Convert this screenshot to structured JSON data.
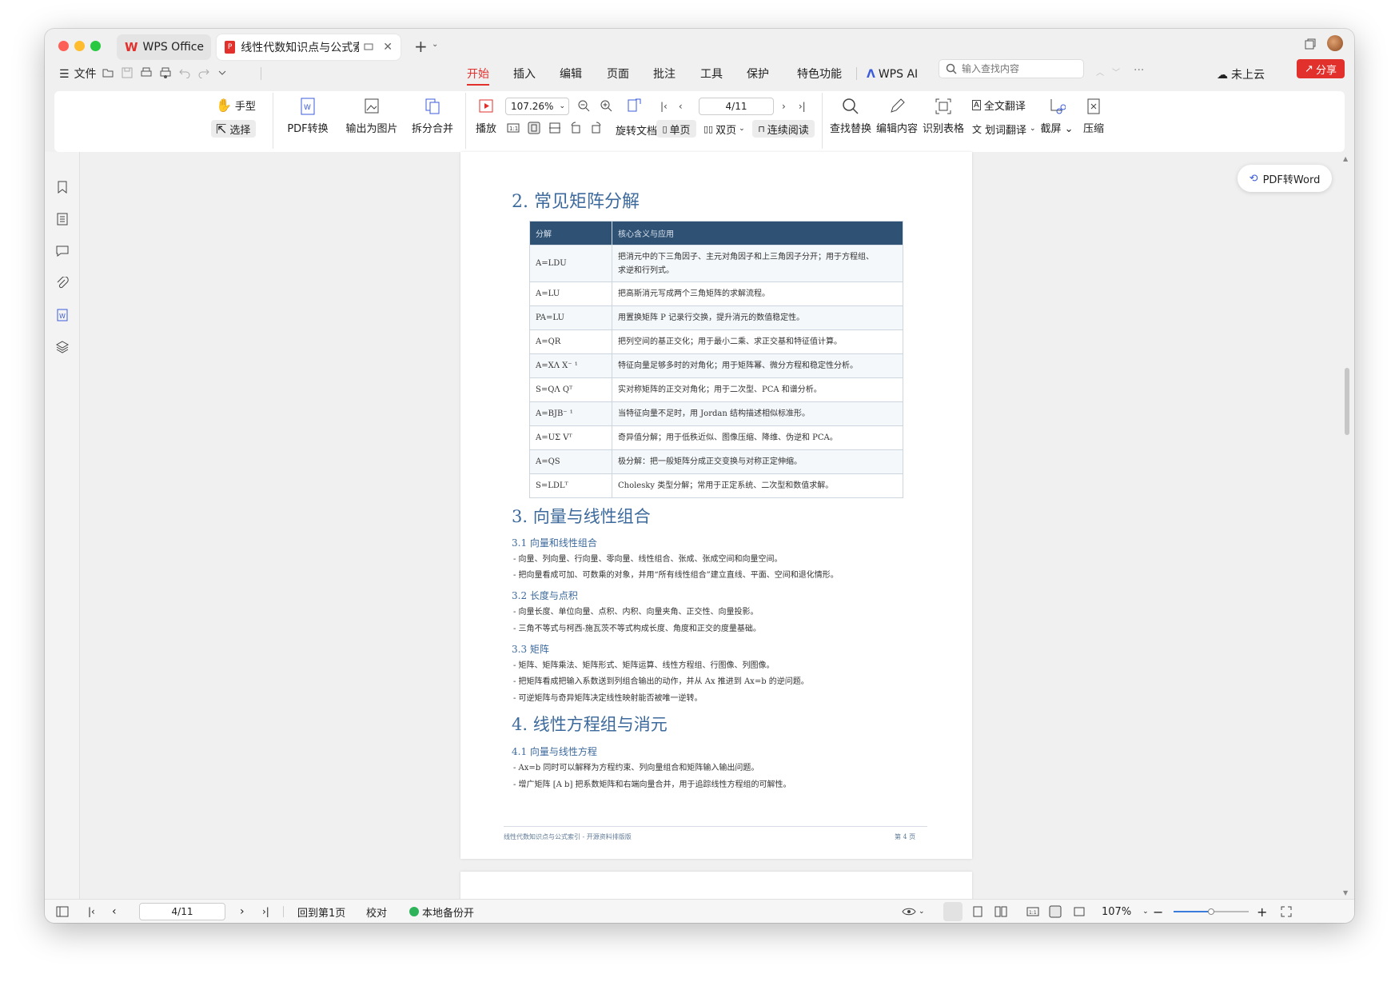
{
  "tabs": [
    {
      "label": "WPS Office"
    },
    {
      "label": "线性代数知识点与公式索引"
    }
  ],
  "menu": {
    "file": "文件",
    "items": [
      "开始",
      "插入",
      "编辑",
      "页面",
      "批注",
      "工具",
      "保护",
      "特色功能"
    ],
    "wps_ai": "WPS AI",
    "search_placeholder": "输入查找内容",
    "cloud": "未上云",
    "share": "分享"
  },
  "toolbar": {
    "hand": "手型",
    "select": "选择",
    "pdf_convert": "PDF转换",
    "export_image": "输出为图片",
    "split_merge": "拆分合并",
    "play": "播放",
    "zoom": "107.26%",
    "page": "4/11",
    "rotate": "旋转文档",
    "single": "单页",
    "double": "双页",
    "continuous": "连续阅读",
    "find_replace": "查找替换",
    "edit_content": "编辑内容",
    "recognize_table": "识别表格",
    "full_translate": "全文翻译",
    "word_translate": "划词翻译",
    "screenshot": "截屏",
    "compress": "压缩"
  },
  "float_button": "PDF转Word",
  "doc": {
    "sec2": "2. 常见矩阵分解",
    "table_header": [
      "分解",
      "核心含义与应用"
    ],
    "table_rows": [
      [
        "A=LDU",
        "把消元中的下三角因子、主元对角因子和上三角因子分开；用于方程组、",
        "求逆和行列式。"
      ],
      [
        "A=LU",
        "把高斯消元写成两个三角矩阵的求解流程。",
        ""
      ],
      [
        "PA=LU",
        "用置换矩阵 P 记录行交换，提升消元的数值稳定性。",
        ""
      ],
      [
        "A=QR",
        "把列空间的基正交化；用于最小二乘、求正交基和特征值计算。",
        ""
      ],
      [
        "A=XΛ X⁻ ¹",
        "特征向量足够多时的对角化；用于矩阵幂、微分方程和稳定性分析。",
        ""
      ],
      [
        "S=QΛ Qᵀ",
        "实对称矩阵的正交对角化；用于二次型、PCA 和谱分析。",
        ""
      ],
      [
        "A=BJB⁻ ¹",
        "当特征向量不足时，用 Jordan 结构描述相似标准形。",
        ""
      ],
      [
        "A=UΣ Vᵀ",
        "奇异值分解；用于低秩近似、图像压缩、降维、伪逆和 PCA。",
        ""
      ],
      [
        "A=QS",
        "极分解：把一般矩阵分成正交变换与对称正定伸缩。",
        ""
      ],
      [
        "S=LDLᵀ",
        "Cholesky 类型分解；常用于正定系统、二次型和数值求解。",
        ""
      ]
    ],
    "sec3": "3. 向量与线性组合",
    "s31": "3.1 向量和线性组合",
    "s31_b": [
      "- 向量、列向量、行向量、零向量、线性组合、张成、张成空间和向量空间。",
      "- 把向量看成可加、可数乘的对象，并用“所有线性组合”建立直线、平面、空间和退化情形。"
    ],
    "s32": "3.2 长度与点积",
    "s32_b": [
      "- 向量长度、单位向量、点积、内积、向量夹角、正交性、向量投影。",
      "- 三角不等式与柯西-施瓦茨不等式构成长度、角度和正交的度量基础。"
    ],
    "s33": "3.3 矩阵",
    "s33_b": [
      "- 矩阵、矩阵乘法、矩阵形式、矩阵运算、线性方程组、行图像、列图像。",
      "- 把矩阵看成把输入系数送到列组合输出的动作，并从 Ax 推进到 Ax=b 的逆问题。",
      "- 可逆矩阵与奇异矩阵决定线性映射能否被唯一逆转。"
    ],
    "sec4": "4. 线性方程组与消元",
    "s41": "4.1 向量与线性方程",
    "s41_b": [
      "- Ax=b 同时可以解释为方程约束、列向量组合和矩阵输入输出问题。",
      "- 增广矩阵 [A b] 把系数矩阵和右端向量合并，用于追踪线性方程组的可解性。"
    ],
    "footer_left": "线性代数知识点与公式索引 - 开源资料排版版",
    "footer_right": "第 4 页"
  },
  "status": {
    "page": "4/11",
    "goto_first": "回到第1页",
    "proof": "校对",
    "backup": "本地备份开",
    "zoom": "107%"
  },
  "zoom_level": 0.5
}
